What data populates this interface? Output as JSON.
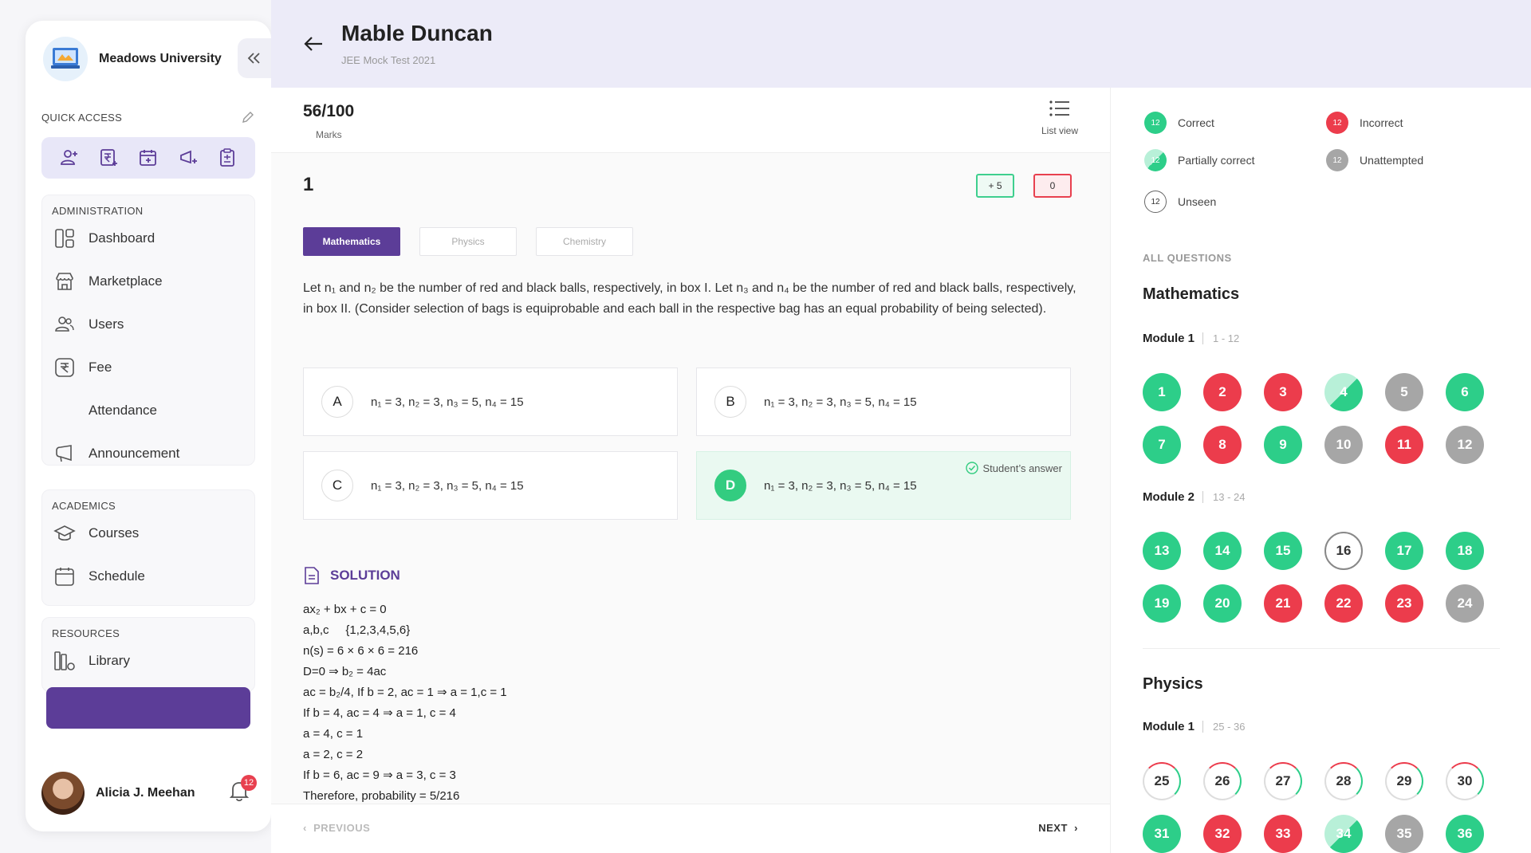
{
  "sidebar": {
    "brand": "Meadows University",
    "quick_access_label": "QUICK ACCESS",
    "groups": [
      {
        "label": "ADMINISTRATION",
        "items": [
          {
            "label": "Dashboard",
            "icon": "dashboard-icon"
          },
          {
            "label": "Marketplace",
            "icon": "marketplace-icon"
          },
          {
            "label": "Users",
            "icon": "users-icon"
          },
          {
            "label": "Fee",
            "icon": "rupee-icon"
          },
          {
            "label": "Attendance",
            "icon": ""
          },
          {
            "label": "Announcement",
            "icon": "megaphone-icon"
          }
        ]
      },
      {
        "label": "ACADEMICS",
        "items": [
          {
            "label": "Courses",
            "icon": "graduation-cap-icon"
          },
          {
            "label": "Schedule",
            "icon": "calendar-icon"
          }
        ]
      },
      {
        "label": "RESOURCES",
        "items": [
          {
            "label": "Library",
            "icon": "library-icon"
          }
        ]
      }
    ],
    "profile": {
      "name": "Alicia J. Meehan",
      "notifications": "12"
    }
  },
  "header": {
    "student": "Mable Duncan",
    "test": "JEE Mock Test 2021"
  },
  "marks": {
    "value": "56/100",
    "label": "Marks",
    "list_view": "List view"
  },
  "question": {
    "number": "1",
    "score_positive": "+ 5",
    "score_negative": "0",
    "tabs": [
      "Mathematics",
      "Physics",
      "Chemistry"
    ],
    "active_tab": "Mathematics",
    "text_line1": "Let n₁ and n₂ be the number of red and black balls, respectively, in box I. Let n₃ and n₄ be the number of red and black balls, respectively,",
    "text_line2": "in box II. (Consider selection of bags is equiprobable and each ball in the respective bag has an equal probability of being selected).",
    "options": [
      {
        "letter": "A",
        "text": "n₁ = 3, n₂ = 3, n₃ = 5, n₄ = 15"
      },
      {
        "letter": "B",
        "text": "n₁ = 3, n₂ = 3, n₃ = 5, n₄ = 15"
      },
      {
        "letter": "C",
        "text": "n₁ = 3, n₂ = 3, n₃ = 5, n₄ = 15"
      },
      {
        "letter": "D",
        "text": "n₁ = 3, n₂ = 3, n₃ = 5, n₄ = 15"
      }
    ],
    "student_answer_label": "Student’s answer",
    "solution_title": "SOLUTION",
    "solution_lines": [
      "ax₂ + bx + c = 0",
      "a,b,c     {1,2,3,4,5,6}",
      "n(s) = 6 × 6 × 6 = 216",
      "D=0 ⇒ b₂ = 4ac",
      "ac = b₂/4, If b = 2, ac = 1 ⇒ a = 1,c = 1",
      "If b = 4, ac = 4 ⇒ a = 1, c = 4",
      "a = 4, c = 1",
      "a = 2, c = 2",
      "If b = 6, ac = 9 ⇒ a = 3, c = 3",
      "Therefore, probability = 5/216"
    ],
    "prev": "PREVIOUS",
    "next": "NEXT"
  },
  "legend": {
    "correct": "Correct",
    "incorrect": "Incorrect",
    "partial": "Partially correct",
    "unattempted": "Unattempted",
    "unseen": "Unseen",
    "count": "12"
  },
  "all_questions": {
    "label": "ALL QUESTIONS",
    "subjects": [
      {
        "name": "Mathematics",
        "modules": [
          {
            "name": "Module 1",
            "range": "1 - 12",
            "questions": [
              [
                "1",
                "correct"
              ],
              [
                "2",
                "incorrect"
              ],
              [
                "3",
                "incorrect"
              ],
              [
                "4",
                "partial"
              ],
              [
                "5",
                "unattempted"
              ],
              [
                "6",
                "correct"
              ],
              [
                "7",
                "correct"
              ],
              [
                "8",
                "incorrect"
              ],
              [
                "9",
                "correct"
              ],
              [
                "10",
                "unattempted"
              ],
              [
                "11",
                "incorrect"
              ],
              [
                "12",
                "unattempted"
              ]
            ]
          },
          {
            "name": "Module 2",
            "range": "13 - 24",
            "questions": [
              [
                "13",
                "correct"
              ],
              [
                "14",
                "correct"
              ],
              [
                "15",
                "correct"
              ],
              [
                "16",
                "unseen"
              ],
              [
                "17",
                "correct"
              ],
              [
                "18",
                "correct"
              ],
              [
                "19",
                "correct"
              ],
              [
                "20",
                "correct"
              ],
              [
                "21",
                "incorrect"
              ],
              [
                "22",
                "incorrect"
              ],
              [
                "23",
                "incorrect"
              ],
              [
                "24",
                "unattempted"
              ]
            ]
          }
        ]
      },
      {
        "name": "Physics",
        "modules": [
          {
            "name": "Module 1",
            "range": "25 - 36",
            "questions": [
              [
                "25",
                "ring"
              ],
              [
                "26",
                "ring"
              ],
              [
                "27",
                "ring"
              ],
              [
                "28",
                "ring"
              ],
              [
                "29",
                "ring"
              ],
              [
                "30",
                "ring"
              ],
              [
                "31",
                "correct"
              ],
              [
                "32",
                "incorrect"
              ],
              [
                "33",
                "incorrect"
              ],
              [
                "34",
                "partial"
              ],
              [
                "35",
                "unattempted"
              ],
              [
                "36",
                "correct"
              ]
            ]
          }
        ]
      }
    ]
  },
  "colors": {
    "accent": "#5c3d98",
    "correct": "#2dce89",
    "incorrect": "#ec3c4c",
    "unattempted": "#a6a6a6"
  }
}
